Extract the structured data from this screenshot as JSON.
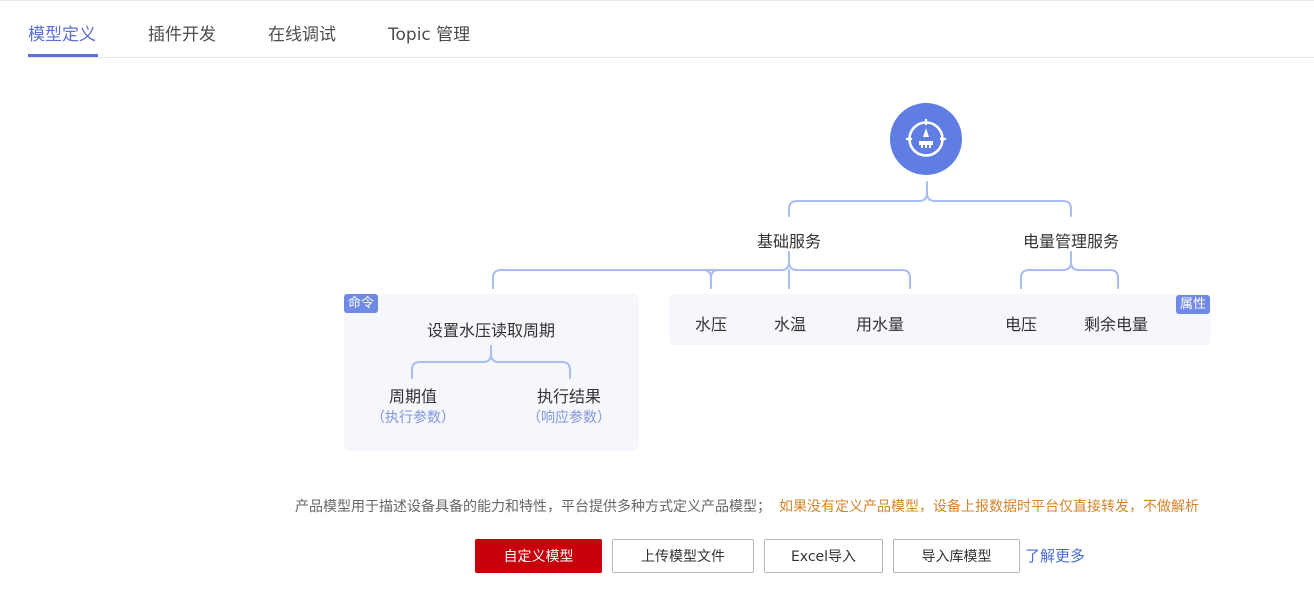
{
  "tabs": [
    {
      "label": "模型定义",
      "active": true
    },
    {
      "label": "插件开发"
    },
    {
      "label": "在线调试"
    },
    {
      "label": "Topic 管理"
    }
  ],
  "diagram": {
    "root_icon": "gauge-icon",
    "services": [
      {
        "label": "基础服务",
        "children": [
          "水压",
          "水温",
          "用水量"
        ]
      },
      {
        "label": "电量管理服务",
        "children": [
          "电压",
          "剩余电量"
        ]
      }
    ],
    "command": {
      "tag": "命令",
      "label": "设置水压读取周期",
      "params": [
        {
          "label": "周期值",
          "sub": "（执行参数）"
        },
        {
          "label": "执行结果",
          "sub": "（响应参数）"
        }
      ]
    },
    "property_tag": "属性"
  },
  "description": {
    "text": "产品模型用于描述设备具备的能力和特性，平台提供多种方式定义产品模型；",
    "warning": "如果没有定义产品模型，设备上报数据时平台仅直接转发，不做解析"
  },
  "buttons": {
    "custom_model": "自定义模型",
    "upload_model_file": "上传模型文件",
    "excel_import": "Excel导入",
    "import_library_model": "导入库模型",
    "learn_more": "了解更多"
  },
  "colors": {
    "accent": "#5b6fd6",
    "primary_button": "#c7000b",
    "warning_text": "#d4842a",
    "connector_line": "#a9bdf0",
    "panel_bg": "#f5f7fc"
  }
}
